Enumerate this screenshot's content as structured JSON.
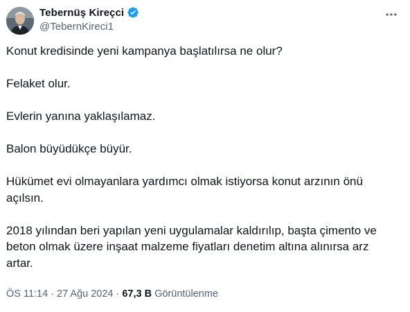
{
  "author": {
    "display_name": "Tebernüş Kireçci",
    "handle": "@TebernKireci1",
    "avatar_icon": "profile-photo",
    "verified_icon": "verified-badge-icon",
    "verified_color": "#1d9bf0"
  },
  "more_icon": "more-horizontal-icon",
  "tweet": {
    "paragraphs": [
      "Konut kredisinde yeni kampanya başlatılırsa ne olur?",
      "Felaket olur.",
      "Evlerin yanına yaklaşılamaz.",
      "Balon büyüdükçe büyür.",
      "Hükümet evi olmayanlara yardımcı olmak istiyorsa konut arzının önü açılsın.",
      "2018 yılından beri yapılan yeni uygulamalar kaldırılıp, başta çimento ve beton olmak üzere inşaat malzeme fiyatları denetim altına alınırsa arz artar."
    ]
  },
  "meta": {
    "time": "ÖS 11:14",
    "separator": "·",
    "date": "27 Ağu 2024",
    "views_count": "67,3 B",
    "views_label": "Görüntülenme"
  },
  "colors": {
    "text_primary": "#0f1419",
    "text_secondary": "#536471",
    "accent": "#1d9bf0"
  }
}
